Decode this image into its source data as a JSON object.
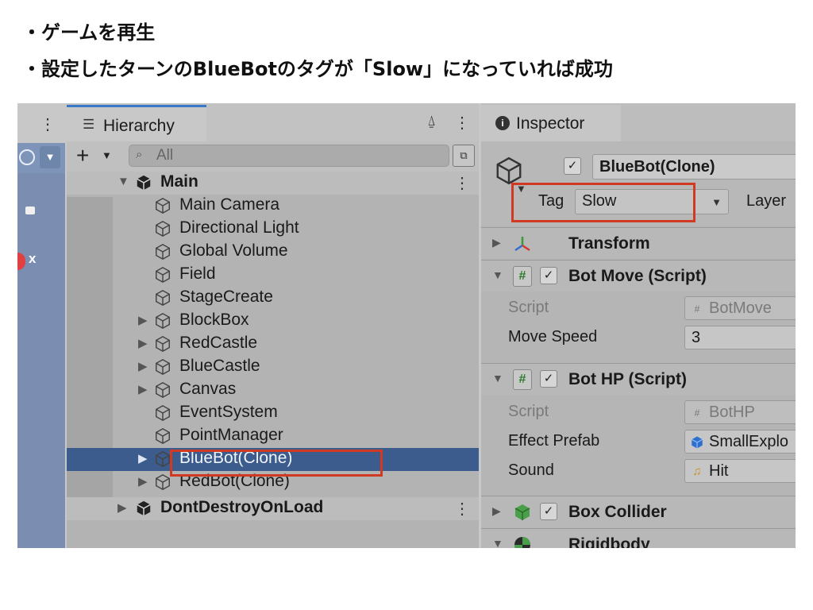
{
  "instructions": [
    "・ゲームを再生",
    "・設定したターンのBlueBotのタグが「Slow」になっていれば成功"
  ],
  "colors": {
    "highlight": "#d13a22",
    "selected_row": "#3c5c8e",
    "tab_accent": "#3a79c8"
  },
  "toolbar_left": {
    "menu_icon": "kebab-icon",
    "scene_icon": "globe-icon",
    "lock_icon": "lock-icon",
    "close_label": "x"
  },
  "hierarchy": {
    "tab_label": "Hierarchy",
    "tab_icon": "list-icon",
    "lock_icon": "lock-icon",
    "menu_icon": "kebab-icon",
    "add_label": "+",
    "search_placeholder": "All",
    "rows": [
      {
        "label": "Main",
        "kind": "scene",
        "expanded": true
      },
      {
        "label": "Main Camera",
        "has_children": false
      },
      {
        "label": "Directional Light",
        "has_children": false
      },
      {
        "label": "Global Volume",
        "has_children": false
      },
      {
        "label": "Field",
        "has_children": false
      },
      {
        "label": "StageCreate",
        "has_children": false
      },
      {
        "label": "BlockBox",
        "has_children": true
      },
      {
        "label": "RedCastle",
        "has_children": true
      },
      {
        "label": "BlueCastle",
        "has_children": true
      },
      {
        "label": "Canvas",
        "has_children": true
      },
      {
        "label": "EventSystem",
        "has_children": false
      },
      {
        "label": "PointManager",
        "has_children": false
      },
      {
        "label": "BlueBot(Clone)",
        "has_children": true,
        "selected": true
      },
      {
        "label": "RedBot(Clone)",
        "has_children": true
      },
      {
        "label": "DontDestroyOnLoad",
        "kind": "scene",
        "expanded": false
      }
    ]
  },
  "inspector": {
    "tab_label": "Inspector",
    "tab_icon": "info-icon",
    "object_name": "BlueBot(Clone)",
    "active": true,
    "tag_label": "Tag",
    "tag_value": "Slow",
    "layer_label": "Layer",
    "components": {
      "transform": {
        "title": "Transform"
      },
      "bot_move": {
        "title": "Bot Move (Script)",
        "enabled": true,
        "script_label": "Script",
        "script_value": "BotMove",
        "move_speed_label": "Move Speed",
        "move_speed_value": "3"
      },
      "bot_hp": {
        "title": "Bot HP (Script)",
        "enabled": true,
        "script_label": "Script",
        "script_value": "BotHP",
        "effect_label": "Effect Prefab",
        "effect_value": "SmallExplo",
        "sound_label": "Sound",
        "sound_value": "Hit"
      },
      "box_collider": {
        "title": "Box Collider",
        "enabled": true
      },
      "rigidbody": {
        "title": "Rigidbody"
      }
    }
  }
}
